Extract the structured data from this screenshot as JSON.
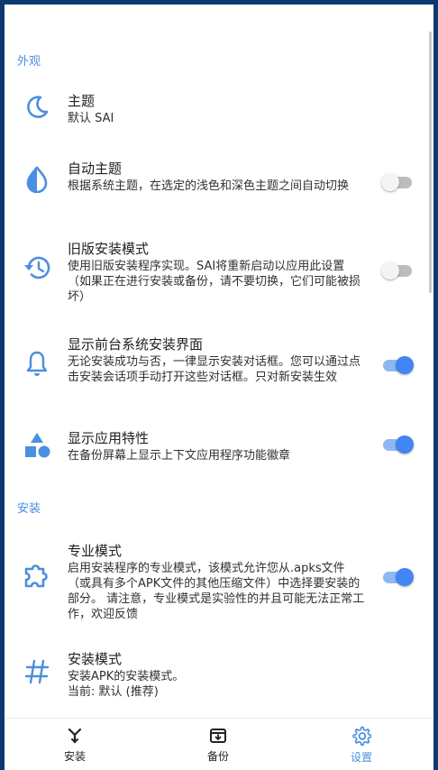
{
  "colors": {
    "accent": "#4285f4",
    "icon": "#4a8fe0",
    "frame": "#0b3a6e"
  },
  "sections": {
    "appearance": "外观",
    "install": "安装"
  },
  "settings": {
    "theme": {
      "title": "主题",
      "summary": "默认 SAI",
      "icon": "moon-icon"
    },
    "auto_theme": {
      "title": "自动主题",
      "summary": "根据系统主题，在选定的浅色和深色主题之间自动切换",
      "icon": "water-drop-icon",
      "enabled": false
    },
    "legacy_install": {
      "title": "旧版安装模式",
      "summary": "使用旧版安装程序实现。SAI将重新启动以应用此设置（如果正在进行安装或备份，请不要切换，它们可能被损坏）",
      "icon": "history-icon",
      "enabled": false
    },
    "show_system_installer": {
      "title": "显示前台系统安装界面",
      "summary": "无论安装成功与否，一律显示安装对话框。您可以通过点击安装会话项手动打开这些对话框。只对新安装生效",
      "icon": "bell-icon",
      "enabled": true
    },
    "app_features": {
      "title": "显示应用特性",
      "summary": "在备份屏幕上显示上下文应用程序功能徽章",
      "icon": "shapes-icon",
      "enabled": true
    },
    "pro_mode": {
      "title": "专业模式",
      "summary": "启用安装程序的专业模式，该模式允许您从.apks文件（或具有多个APK文件的其他压缩文件）中选择要安装的部分。 请注意，专业模式是实验性的并且可能无法正常工作，欢迎反馈",
      "icon": "puzzle-icon",
      "enabled": true
    },
    "install_mode": {
      "title": "安装模式",
      "summary_line1": "安装APK的安装模式。",
      "summary_line2": "当前: 默认 (推荐)",
      "icon": "hash-icon"
    }
  },
  "bottom_nav": {
    "install": {
      "label": "安装",
      "icon": "install-icon"
    },
    "backup": {
      "label": "备份",
      "icon": "backup-icon"
    },
    "settings": {
      "label": "设置",
      "icon": "settings-icon",
      "active": true
    }
  }
}
